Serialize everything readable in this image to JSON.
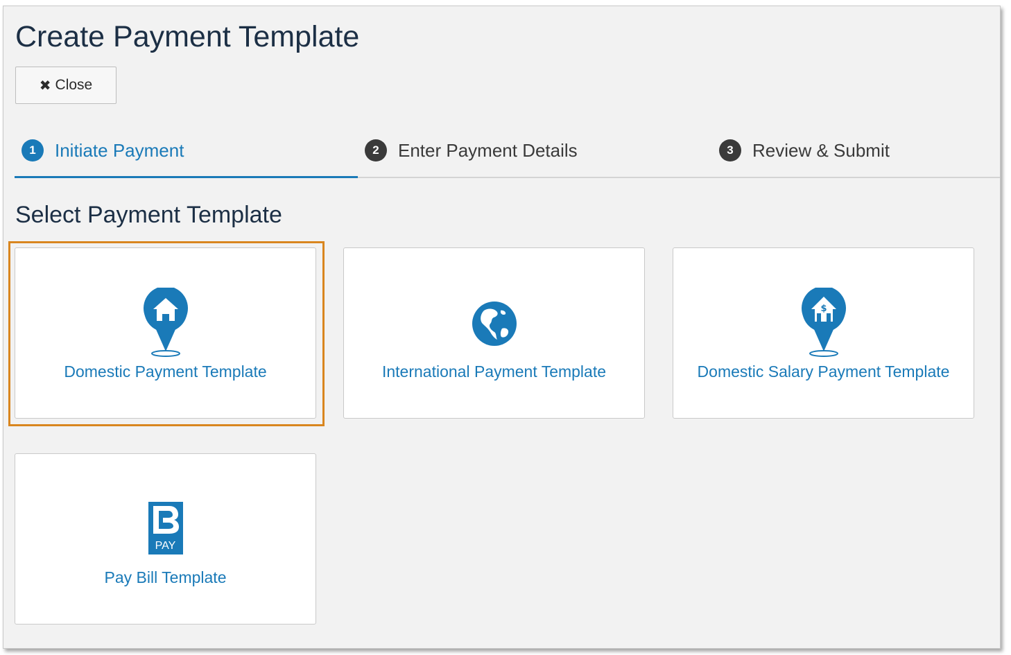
{
  "page": {
    "title": "Create Payment Template"
  },
  "toolbar": {
    "close_label": "Close"
  },
  "steps": [
    {
      "number": "1",
      "label": "Initiate Payment",
      "active": true
    },
    {
      "number": "2",
      "label": "Enter Payment Details",
      "active": false
    },
    {
      "number": "3",
      "label": "Review & Submit",
      "active": false
    }
  ],
  "section": {
    "title": "Select Payment Template"
  },
  "templates": [
    {
      "label": "Domestic Payment Template",
      "icon": "house-pin-icon",
      "selected": true
    },
    {
      "label": "International Payment Template",
      "icon": "globe-icon",
      "selected": false
    },
    {
      "label": "Domestic Salary Payment Template",
      "icon": "salary-house-pin-icon",
      "selected": false
    },
    {
      "label": "Pay Bill Template",
      "icon": "bpay-icon",
      "selected": false,
      "icon_text": "PAY"
    }
  ],
  "colors": {
    "accent": "#1a7ab8",
    "highlight": "#d9861f",
    "title": "#1c2f45"
  }
}
